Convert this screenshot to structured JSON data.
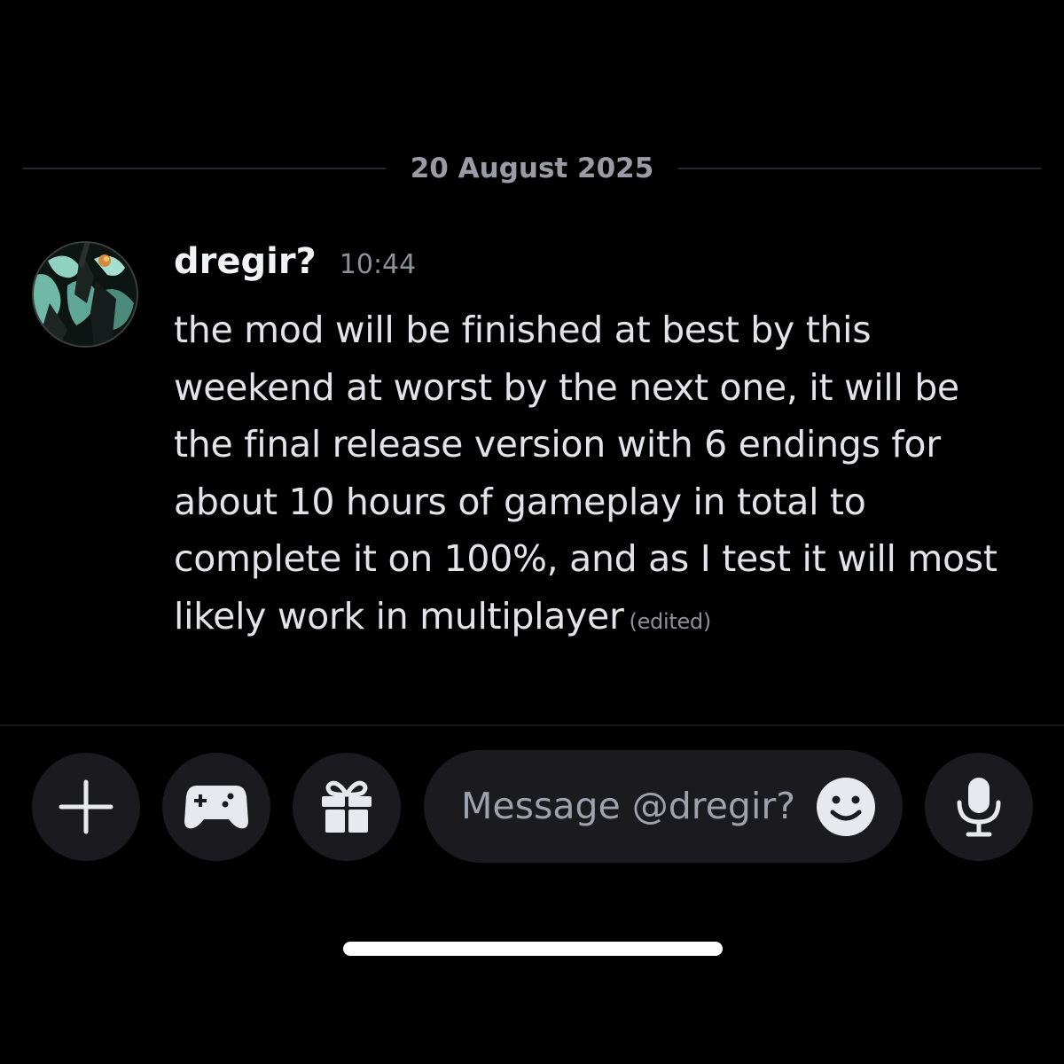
{
  "chat": {
    "date_divider": "20 August 2025",
    "message": {
      "username": "dregir?",
      "timestamp": "10:44",
      "lines": [
        "the mod will be finished at best by this",
        "weekend at worst by the next one, it will be",
        "the final release version with 6 endings for",
        "about 10 hours of gameplay in total to",
        "complete it on 100%, and as I test it will most",
        "likely work in multiplayer"
      ],
      "edited_label": "(edited)"
    }
  },
  "composer": {
    "placeholder": "Message @dregir?",
    "buttons": {
      "add": "plus-icon",
      "activities": "gamepad-icon",
      "gift": "gift-icon",
      "emoji": "smile-icon",
      "voice": "microphone-icon"
    }
  },
  "colors": {
    "background": "#000000",
    "surface": "#1a1a1f",
    "text_primary": "#e3e4e8",
    "text_muted": "#8e9099",
    "divider": "#27272d"
  }
}
